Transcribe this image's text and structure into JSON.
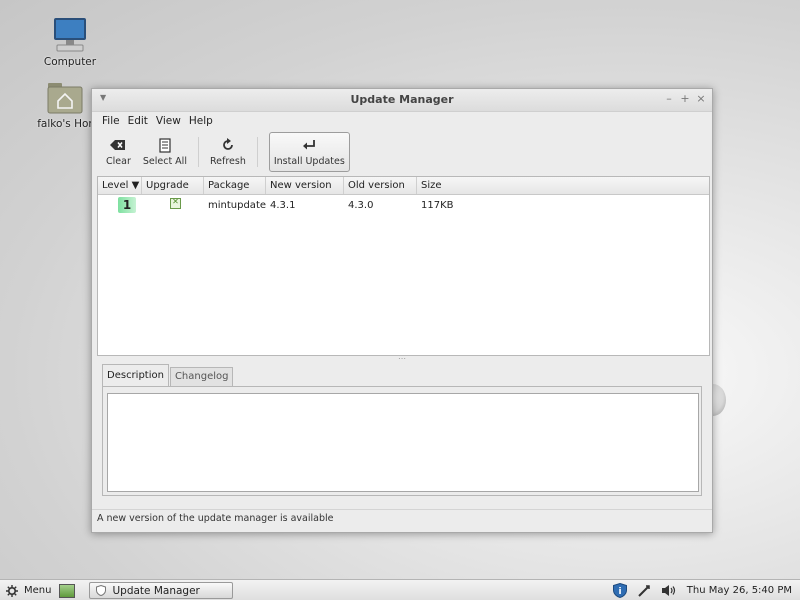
{
  "desktop": {
    "icons": [
      {
        "label": "Computer",
        "icon": "computer-icon"
      },
      {
        "label": "falko's Hor",
        "icon": "home-folder-icon"
      }
    ]
  },
  "window": {
    "title": "Update Manager",
    "menu": {
      "file": "File",
      "edit": "Edit",
      "view": "View",
      "help": "Help"
    },
    "toolbar": {
      "clear": "Clear",
      "select_all": "Select All",
      "refresh": "Refresh",
      "install_updates": "Install Updates"
    },
    "table": {
      "columns": {
        "level": "Level",
        "upgrade": "Upgrade",
        "package": "Package",
        "new_version": "New version",
        "old_version": "Old version",
        "size": "Size"
      },
      "rows": [
        {
          "level": "1",
          "upgrade_checked": true,
          "package": "mintupdate",
          "new_version": "4.3.1",
          "old_version": "4.3.0",
          "size": "117KB"
        }
      ]
    },
    "tabs": {
      "description": "Description",
      "changelog": "Changelog"
    },
    "status": "A new version of the update manager is available"
  },
  "taskbar": {
    "menu_label": "Menu",
    "task_label": "Update Manager",
    "clock": "Thu May 26,  5:40 PM"
  },
  "colors": {
    "level_badge": "#7ee0a0",
    "checkbox_green": "#4e8a28"
  }
}
